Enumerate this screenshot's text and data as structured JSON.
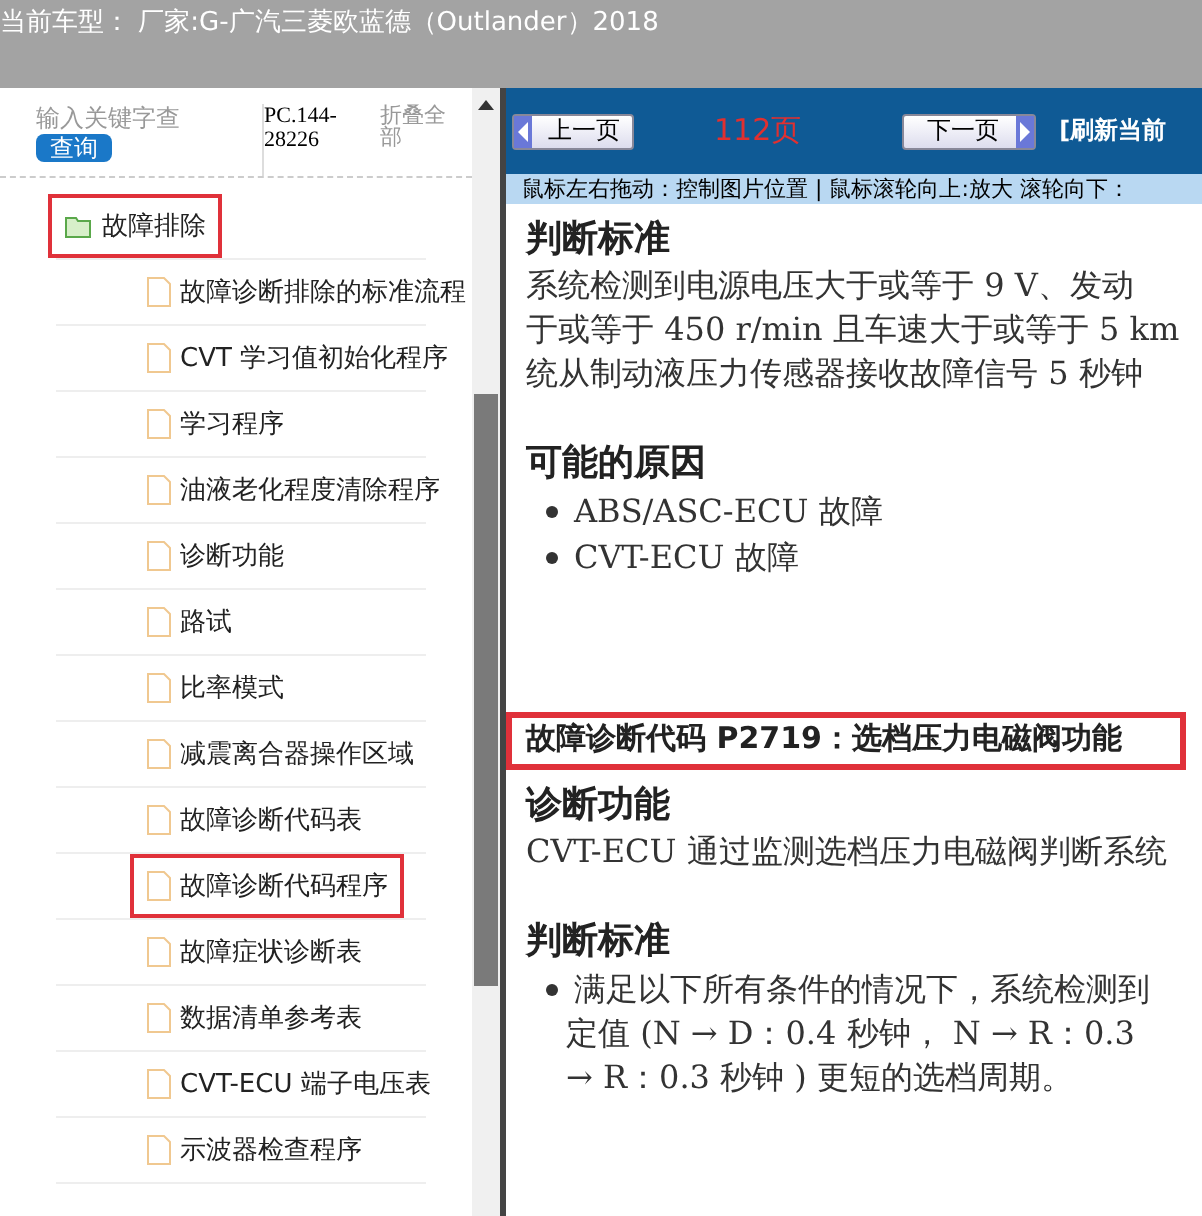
{
  "title": "当前车型： 厂家:G-广汽三菱欧蓝德（Outlander）2018",
  "sidebar": {
    "search": {
      "placeholder": "输入关键字查"
    },
    "search_button": "查询",
    "code": "PC.144-28226",
    "collapse_all": "折叠全部",
    "tree": [
      {
        "label": "故障排除",
        "expanded": true,
        "highlighted": true,
        "children": [
          {
            "label": "故障诊断排除的标准流程",
            "highlighted": false
          },
          {
            "label": "CVT 学习值初始化程序",
            "highlighted": false
          },
          {
            "label": "学习程序",
            "highlighted": false
          },
          {
            "label": "油液老化程度清除程序",
            "highlighted": false
          },
          {
            "label": "诊断功能",
            "highlighted": false
          },
          {
            "label": "路试",
            "highlighted": false
          },
          {
            "label": "比率模式",
            "highlighted": false
          },
          {
            "label": "减震离合器操作区域",
            "highlighted": false
          },
          {
            "label": "故障诊断代码表",
            "highlighted": false
          },
          {
            "label": "故障诊断代码程序",
            "highlighted": true
          },
          {
            "label": "故障症状诊断表",
            "highlighted": false
          },
          {
            "label": "数据清单参考表",
            "highlighted": false
          },
          {
            "label": "CVT-ECU 端子电压表",
            "highlighted": false
          },
          {
            "label": "示波器检查程序",
            "highlighted": false
          }
        ]
      }
    ]
  },
  "toolbar": {
    "prev": "上一页",
    "page": "112页",
    "next": "下一页",
    "refresh": "[刷新当前"
  },
  "hint": "鼠标左右拖动：控制图片位置 | 鼠标滚轮向上:放大  滚轮向下：",
  "document": [
    {
      "kind": "heading",
      "text": "判断标准"
    },
    {
      "kind": "line",
      "text": "系统检测到电源电压大于或等于 9 V、发动"
    },
    {
      "kind": "line",
      "text": "于或等于 450 r/min 且车速大于或等于 5 km"
    },
    {
      "kind": "line",
      "text": "统从制动液压力传感器接收故障信号 5 秒钟"
    },
    {
      "kind": "gap"
    },
    {
      "kind": "heading",
      "text": "可能的原因"
    },
    {
      "kind": "bullet",
      "text": "ABS/ASC-ECU 故障"
    },
    {
      "kind": "bullet",
      "text": "CVT-ECU 故障"
    },
    {
      "kind": "gap"
    },
    {
      "kind": "gap"
    },
    {
      "kind": "gap"
    },
    {
      "kind": "title",
      "text": "故障诊断代码 **P2719**：选档压力电磁阀功能",
      "highlighted": true
    },
    {
      "kind": "heading",
      "text": "诊断功能"
    },
    {
      "kind": "line",
      "text": "CVT-ECU 通过监测选档压力电磁阀判断系统"
    },
    {
      "kind": "gap"
    },
    {
      "kind": "heading",
      "text": "判断标准"
    },
    {
      "kind": "bullet",
      "text": "满足以下所有条件的情况下，系统检测到"
    },
    {
      "kind": "line",
      "text": "定值 (N → D：0.4 秒钟， N → R：0.3",
      "indent": true
    },
    {
      "kind": "line",
      "text": "→ R：0.3 秒钟 ) 更短的选档周期。",
      "indent": true
    }
  ]
}
